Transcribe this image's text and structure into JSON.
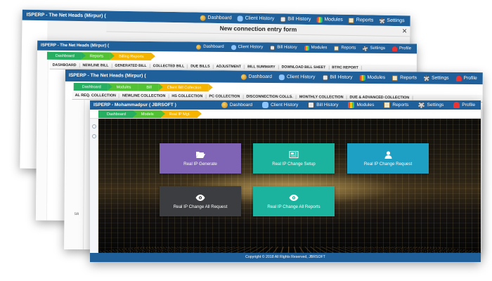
{
  "colors": {
    "topbar": "#1f5f9a",
    "crumb_green": "#27ae60",
    "crumb_lightgreen": "#52c234",
    "crumb_yellow": "#f4b400",
    "tile_purple": "#7f64b5",
    "tile_teal": "#1cb39e",
    "tile_cyan": "#1e9fc4",
    "tile_dark": "#3c3d40"
  },
  "win1": {
    "brand": "ISPERP - The Net Heads (Mirpur) (",
    "modal_title": "New connection entry form",
    "nav": {
      "dashboard": "Dashboard",
      "client_history": "Client History",
      "bill_history": "Bill History",
      "modules": "Modules",
      "reports": "Reports",
      "settings": "Settings"
    }
  },
  "win2": {
    "brand": "ISPERP - The Net Heads (Mirpur) (",
    "nav": {
      "dashboard": "Dashboard",
      "client_history": "Client History",
      "bill_history": "Bill History",
      "modules": "Modules",
      "reports": "Reports",
      "settings": "Settings",
      "profile": "Profile"
    },
    "crumbs": [
      "Dashboard",
      "Reports",
      "Billing Reports"
    ],
    "tabs": [
      "DASHBOARD",
      "NEWLINE BILL",
      "GENERATED BILL",
      "COLLECTED BILL",
      "DUE BILLS",
      "ADJUSTMENT",
      "BILL SUMMARY",
      "DOWNLOAD BILL SHEET",
      "BTRC REPORT"
    ]
  },
  "win3": {
    "brand": "ISPERP - The Net Heads (Mirpur) (",
    "nav": {
      "dashboard": "Dashboard",
      "client_history": "Client History",
      "bill_history": "Bill History",
      "modules": "Modules",
      "reports": "Reports",
      "settings": "Settings",
      "profile": "Profile"
    },
    "crumbs": [
      "Dashboard",
      "Modules",
      "Bill",
      "Client Bill Collection"
    ],
    "tabs": [
      "AL REQ. COLLECTION",
      "NEWLINE COLLECTION",
      "HS COLLECTION",
      "PC COLLECTION",
      "DISCONNECTION COLLS.",
      "MONTHLY COLLECTION",
      "DUE & ADVANCED COLLECTION"
    ],
    "stub": "SR"
  },
  "win4": {
    "brand": "ISPERP - Mohammadpur ( JBRSOFT )",
    "nav": {
      "dashboard": "Dashboard",
      "client_history": "Client History",
      "bill_history": "Bill History",
      "modules": "Modules",
      "reports": "Reports",
      "settings": "Settings",
      "profile": "Profile"
    },
    "crumbs": [
      "Dashboard",
      "Models",
      "Real IP Mgt."
    ],
    "tiles": {
      "generate": {
        "label": "Real IP Generate",
        "icon": "folder-open-icon"
      },
      "change_setup": {
        "label": "Real IP Change Setup",
        "icon": "newspaper-icon"
      },
      "change_request": {
        "label": "Real IP Change Request",
        "icon": "user-icon"
      },
      "change_all_request": {
        "label": "Real IP Change All Request",
        "icon": "eye-icon"
      },
      "change_all_reports": {
        "label": "Real IP Change All Reports",
        "icon": "eye-icon"
      }
    },
    "footer": "Copyright © 2018 All Rights Reserved, JBRSOFT"
  }
}
